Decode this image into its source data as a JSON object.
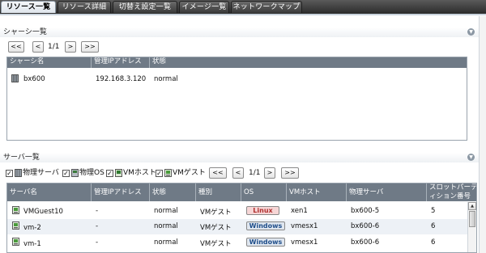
{
  "tabs": [
    "リソース一覧",
    "リソース詳細",
    "切替え設定一覧",
    "イメージ一覧",
    "ネットワークマップ"
  ],
  "chassis": {
    "title": "シャーシ一覧",
    "pager": {
      "first": "<<",
      "prev": "<",
      "info": "1/1",
      "next": ">",
      "last": ">>"
    },
    "columns": [
      "シャーシ名",
      "管理IPアドレス",
      "状態"
    ],
    "rows": [
      {
        "name": "bx600",
        "ip": "192.168.3.120",
        "status": "normal"
      }
    ]
  },
  "servers": {
    "title": "サーバ一覧",
    "filters": [
      {
        "label": "物理サーバ",
        "checked": true
      },
      {
        "label": "物理OS",
        "checked": true
      },
      {
        "label": "VMホスト",
        "checked": true
      },
      {
        "label": "VMゲスト",
        "checked": true
      }
    ],
    "pager": {
      "first": "<<",
      "prev": "<",
      "info": "1/1",
      "next": ">",
      "last": ">>"
    },
    "columns": [
      "サーバ名",
      "管理IPアドレス",
      "状態",
      "種別",
      "OS",
      "VMホスト",
      "物理サーバ",
      "スロットパーティション番号"
    ],
    "rows": [
      {
        "name": "VMGuest10",
        "ip": "-",
        "status": "normal",
        "type": "VMゲスト",
        "os": "Linux",
        "vmhost": "xen1",
        "physical": "bx600-5",
        "slot": "5"
      },
      {
        "name": "vm-2",
        "ip": "-",
        "status": "normal",
        "type": "VMゲスト",
        "os": "Windows",
        "vmhost": "vmesx1",
        "physical": "bx600-6",
        "slot": "6"
      },
      {
        "name": "vm-1",
        "ip": "-",
        "status": "normal",
        "type": "VMゲスト",
        "os": "Windows",
        "vmhost": "vmesx1",
        "physical": "bx600-6",
        "slot": "6"
      }
    ]
  },
  "icons": {
    "collapse": "chevron-down-icon",
    "chassis": "chassis-icon",
    "server": "vm-server-icon",
    "check": "✓"
  },
  "colors": {
    "header_row": "#6f7a86",
    "tab_bg": "#3a3a3a",
    "linux_badge": "#f6d6d6",
    "windows_badge": "#dfe6ef",
    "row_alt": "#edf1f6"
  }
}
